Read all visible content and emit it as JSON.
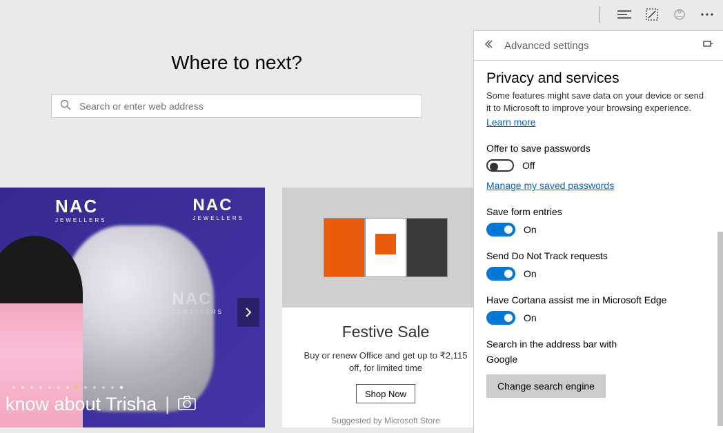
{
  "toolbar": {
    "icons": [
      "menu-icon",
      "web-note-icon",
      "share-icon",
      "more-icon"
    ]
  },
  "main": {
    "heading": "Where to next?",
    "search_placeholder": "Search or enter web address"
  },
  "card1": {
    "brand": "NAC",
    "brand_sub": "JEWELLERS",
    "caption": "know about Trisha"
  },
  "card2": {
    "title": "Festive Sale",
    "desc": "Buy or renew Office and get up to ₹2,115 off, for limited time",
    "button": "Shop Now",
    "suggested": "Suggested by Microsoft Store"
  },
  "panel": {
    "title": "Advanced settings",
    "section_title": "Privacy and services",
    "section_sub": "Some features might save data on your device or send it to Microsoft to improve your browsing experience.",
    "learn_more": "Learn more",
    "settings": {
      "save_passwords": {
        "label": "Offer to save passwords",
        "state": "Off"
      },
      "manage_passwords_link": "Manage my saved passwords",
      "form_entries": {
        "label": "Save form entries",
        "state": "On"
      },
      "dnt": {
        "label": "Send Do Not Track requests",
        "state": "On"
      },
      "cortana": {
        "label": "Have Cortana assist me in Microsoft Edge",
        "state": "On"
      },
      "search_bar": {
        "label": "Search in the address bar with",
        "engine": "Google",
        "button": "Change search engine"
      }
    }
  }
}
